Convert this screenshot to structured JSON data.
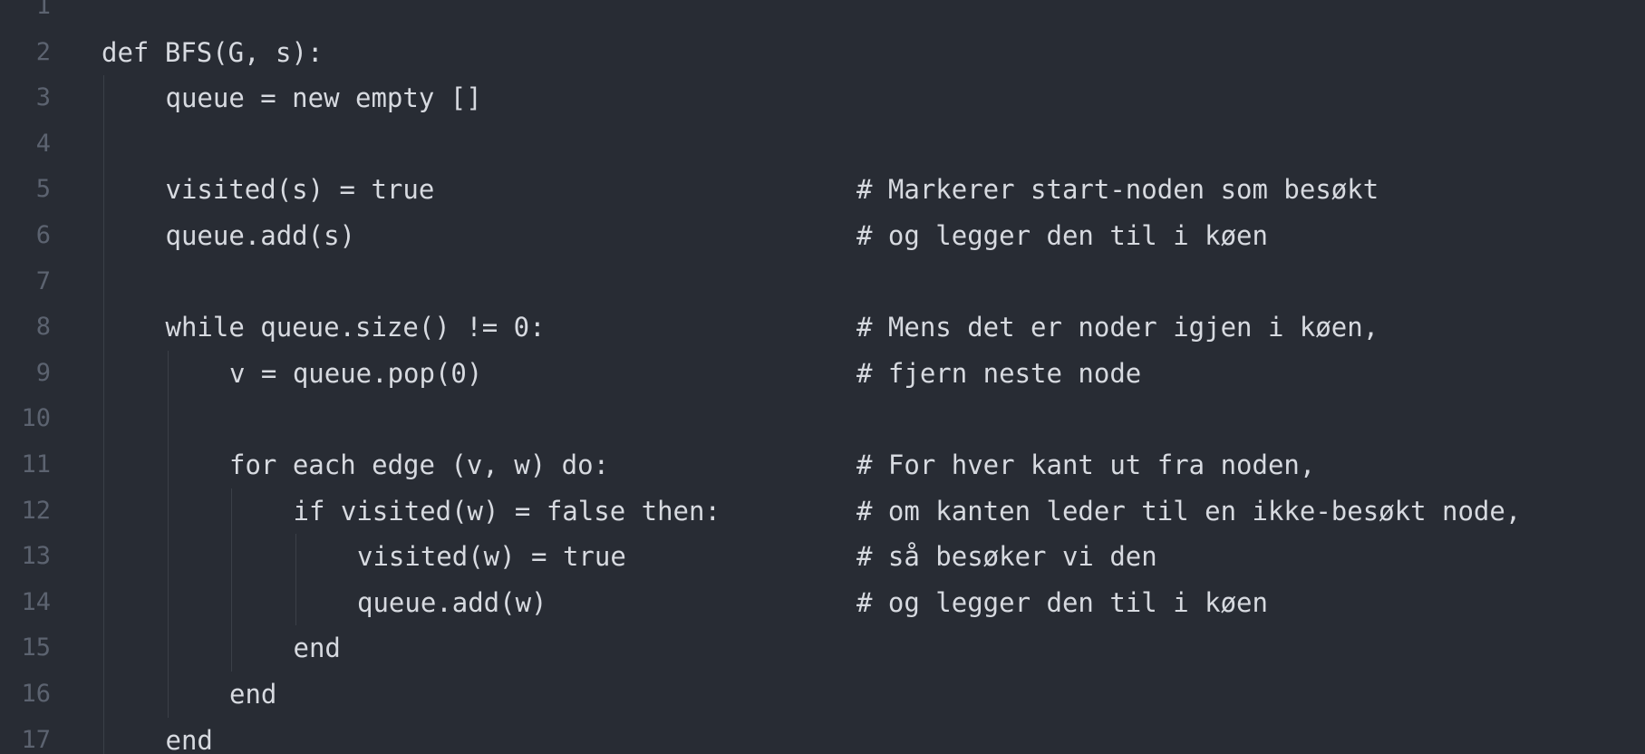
{
  "editor": {
    "lines": [
      {
        "num": "1",
        "indent": 0,
        "code": "",
        "comment": ""
      },
      {
        "num": "2",
        "indent": 0,
        "code": "def BFS(G, s):",
        "comment": ""
      },
      {
        "num": "3",
        "indent": 1,
        "code": "queue = new empty []",
        "comment": ""
      },
      {
        "num": "4",
        "indent": 1,
        "code": "",
        "comment": ""
      },
      {
        "num": "5",
        "indent": 1,
        "code": "visited(s) = true",
        "comment": "# Markerer start-noden som besøkt"
      },
      {
        "num": "6",
        "indent": 1,
        "code": "queue.add(s)",
        "comment": "# og legger den til i køen"
      },
      {
        "num": "7",
        "indent": 1,
        "code": "",
        "comment": ""
      },
      {
        "num": "8",
        "indent": 1,
        "code": "while queue.size() != 0:",
        "comment": "# Mens det er noder igjen i køen,"
      },
      {
        "num": "9",
        "indent": 2,
        "code": "v = queue.pop(0)",
        "comment": "# fjern neste node"
      },
      {
        "num": "10",
        "indent": 2,
        "code": "",
        "comment": ""
      },
      {
        "num": "11",
        "indent": 2,
        "code": "for each edge (v, w) do:",
        "comment": "# For hver kant ut fra noden,"
      },
      {
        "num": "12",
        "indent": 3,
        "code": "if visited(w) = false then:",
        "comment": "# om kanten leder til en ikke-besøkt node,"
      },
      {
        "num": "13",
        "indent": 4,
        "code": "visited(w) = true",
        "comment": "# så besøker vi den"
      },
      {
        "num": "14",
        "indent": 4,
        "code": "queue.add(w)",
        "comment": "# og legger den til i køen"
      },
      {
        "num": "15",
        "indent": 3,
        "code": "end",
        "comment": ""
      },
      {
        "num": "16",
        "indent": 2,
        "code": "end",
        "comment": ""
      },
      {
        "num": "17",
        "indent": 1,
        "code": "end",
        "comment": ""
      }
    ]
  },
  "colors": {
    "background": "#282c34",
    "text": "#d7dae0",
    "gutter": "#5c6370",
    "indent_guide": "#3b4048"
  }
}
